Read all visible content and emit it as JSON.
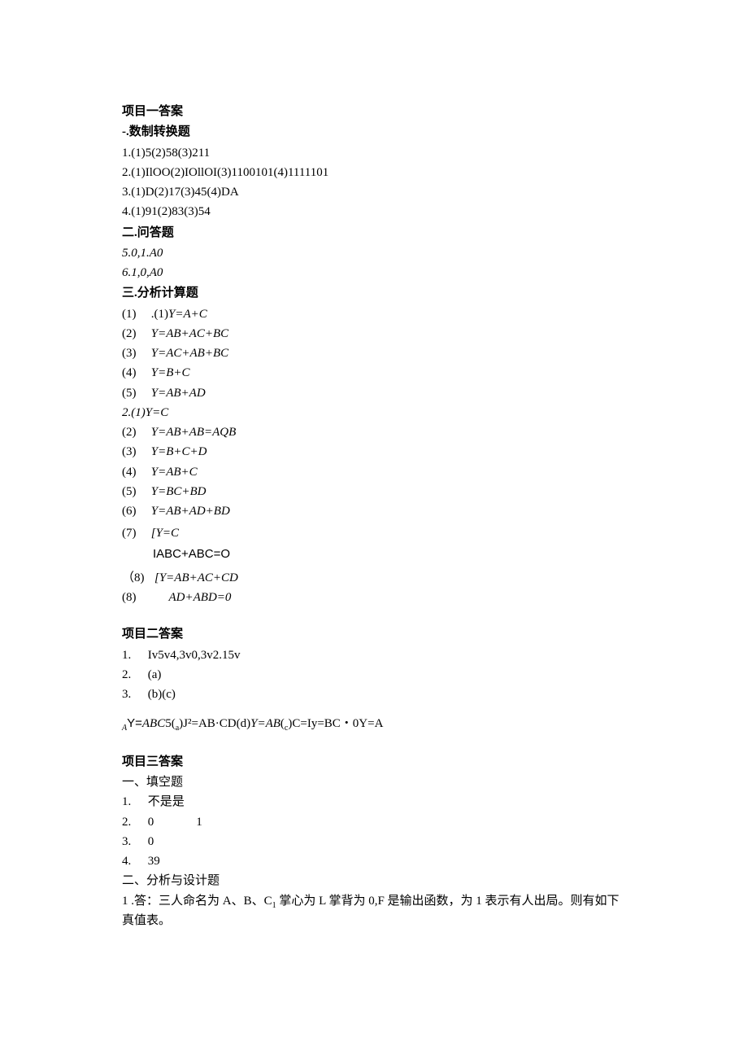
{
  "section1": {
    "title": "项目一答案",
    "part1_title": "-.数制转换题",
    "p1_lines": [
      "1.(1)5(2)58(3)211",
      "2.(1)IlOO(2)IOllOI(3)1100101(4)1111101",
      "3.(1)D(2)17(3)45(4)DA",
      "4.(1)91(2)83(3)54"
    ],
    "part2_title": "二.问答题",
    "p2_lines": [
      "5.0,1.A0",
      "6.1,0,A0"
    ],
    "part3_title": "三.分析计算题",
    "p3_group1_first_num": "(1)",
    "p3_group1_first_prefix": ".(1)",
    "p3_group1_first": "Y=A+C",
    "p3_group1": [
      {
        "num": "(2)",
        "val": "Y=AB+AC+BC"
      },
      {
        "num": "(3)",
        "val": "Y=AC+AB+BC"
      },
      {
        "num": "(4)",
        "val": "Y=B+C"
      },
      {
        "num": "(5)",
        "val": "Y=AB+AD"
      }
    ],
    "p3_group2_first": "2.(1)Y=C",
    "p3_group2": [
      {
        "num": "(2)",
        "val": "Y=AB+AB=AQB"
      },
      {
        "num": "(3)",
        "val": "Y=B+C+D"
      },
      {
        "num": "(4)",
        "val": "Y=AB+C"
      },
      {
        "num": "(5)",
        "val": "Y=BC+BD"
      },
      {
        "num": "(6)",
        "val": "Y=AB+AD+BD"
      }
    ],
    "p3_item7_num": "(7)",
    "p3_item7_a": "[Y=C",
    "p3_item7_b": "IABC+ABC=O",
    "p3_item8a_num": "（8)",
    "p3_item8a": "[Y=AB+AC+CD",
    "p3_item8b_num": "(8)",
    "p3_item8b": "AD+ABD=0"
  },
  "section2": {
    "title": "项目二答案",
    "items": [
      {
        "num": "1.",
        "val": "Iv5v4,3v0,3v2.15v"
      },
      {
        "num": "2.",
        "val": "(a)"
      },
      {
        "num": "3.",
        "val": "(b)(c)"
      }
    ],
    "formula_prefix_sub": "A",
    "formula_line_a": "Y=",
    "formula_line_b": "ABC",
    "formula_line_c": "5(",
    "formula_sub_a": "a",
    "formula_line_d": ")J²=AB·CD(d)",
    "formula_line_e": "Y=AB",
    "formula_line_f": "(",
    "formula_sub_c": "c",
    "formula_line_g": ")C=Iy=BC・0Y=A"
  },
  "section3": {
    "title": "项目三答案",
    "part1_title": "一、填空题",
    "fill": [
      {
        "num": "1.",
        "a": "不是",
        "b": "是"
      },
      {
        "num": "2.",
        "a": "0",
        "b": "1"
      },
      {
        "num": "3.",
        "a": "0",
        "b": ""
      },
      {
        "num": "4.",
        "a": "39",
        "b": ""
      }
    ],
    "part2_title": "二、分析与设计题",
    "q1_num": "1",
    "q1_text": ".答：三人命名为 A、B、C",
    "q1_sub": "1",
    "q1_text2": " 掌心为 L 掌背为 0,F 是输出函数，为 1 表示有人出局。则有如下真值表。"
  }
}
